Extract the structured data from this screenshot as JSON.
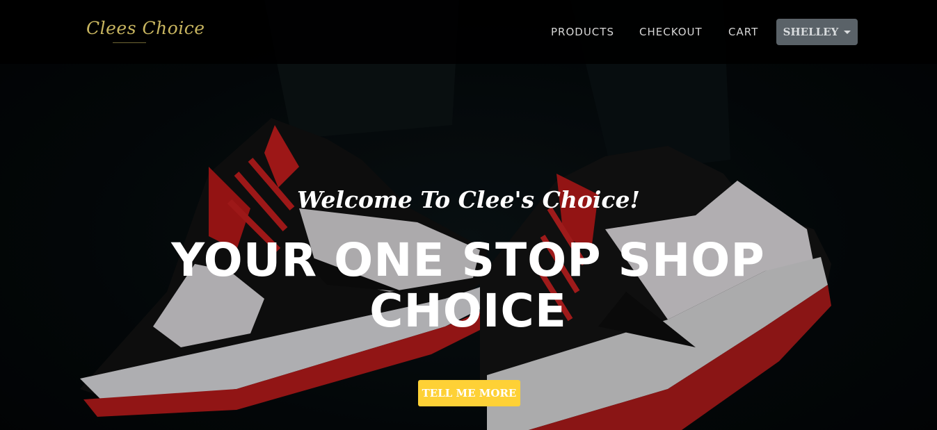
{
  "brand": {
    "name": "Clees Choice",
    "color": "#c9b660"
  },
  "nav": {
    "items": [
      {
        "label": "PRODUCTS"
      },
      {
        "label": "CHECKOUT"
      },
      {
        "label": "CART"
      }
    ],
    "user_label": "SHELLEY",
    "user_icon": "chevron-down-icon"
  },
  "hero": {
    "welcome": "Welcome To Clee's Choice!",
    "headline_line1": "YOUR ONE STOP SHOP",
    "headline_line2": "CHOICE",
    "cta_label": "TELL ME MORE",
    "cta_color": "#fed136",
    "image": "sneakers-photo"
  }
}
